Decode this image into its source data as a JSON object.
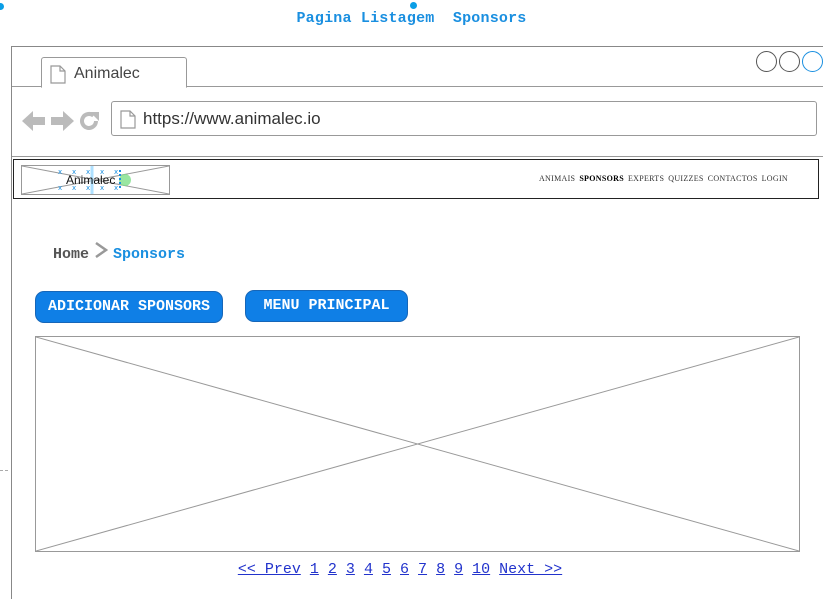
{
  "page": {
    "title": "Pagina Listagem  Sponsors"
  },
  "browser": {
    "tab_label": "Animalec",
    "url": "https://www.animalec.io"
  },
  "site_nav": {
    "logo_text": "Animalec",
    "items": [
      {
        "label": "ANIMAIS"
      },
      {
        "label": "SPONSORS"
      },
      {
        "label": "EXPERTS"
      },
      {
        "label": "QUIZZES"
      },
      {
        "label": "CONTACTOS"
      },
      {
        "label": "LOGIN"
      }
    ],
    "current": "SPONSORS"
  },
  "breadcrumb": {
    "home": "Home",
    "separator": ">",
    "current": "Sponsors"
  },
  "actions": {
    "add_label": "ADICIONAR SPONSORS",
    "menu_label": "MENU PRINCIPAL"
  },
  "pagination": {
    "prev": "<< Prev",
    "pages": [
      "1",
      "2",
      "3",
      "4",
      "5",
      "6",
      "7",
      "8",
      "9",
      "10"
    ],
    "next": "Next >>"
  },
  "colors": {
    "accent": "#1a8fe0",
    "button_bg": "#0f7fe6",
    "link": "#2233cc"
  },
  "icons": [
    "page-icon",
    "back-arrow-icon",
    "forward-arrow-icon",
    "reload-icon",
    "window-button-icon",
    "chevron-right-icon"
  ]
}
